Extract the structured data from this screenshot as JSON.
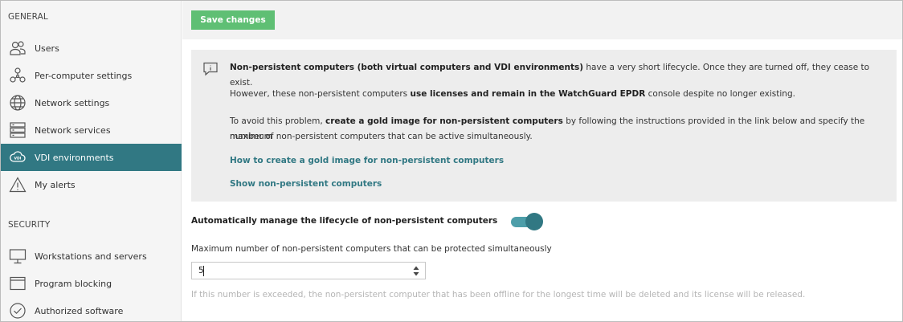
{
  "sidebar": {
    "sections": [
      {
        "title": "GENERAL"
      },
      {
        "title": "SECURITY"
      }
    ],
    "general_items": [
      {
        "label": "Users",
        "icon": "users-icon"
      },
      {
        "label": "Per-computer settings",
        "icon": "network-nodes-icon"
      },
      {
        "label": "Network settings",
        "icon": "globe-icon"
      },
      {
        "label": "Network services",
        "icon": "server-icon"
      },
      {
        "label": "VDI environments",
        "icon": "vdi-cloud-icon",
        "active": true
      },
      {
        "label": "My alerts",
        "icon": "warning-icon"
      }
    ],
    "security_items": [
      {
        "label": "Workstations and servers",
        "icon": "monitor-icon"
      },
      {
        "label": "Program blocking",
        "icon": "window-icon"
      },
      {
        "label": "Authorized software",
        "icon": "check-circle-icon"
      }
    ]
  },
  "toolbar": {
    "save_label": "Save changes"
  },
  "info": {
    "p1_bold": "Non-persistent computers (both virtual computers and VDI environments)",
    "p1_rest": " have a very short lifecycle. Once they are turned off, they cease to exist.",
    "p2_start": "However, these non-persistent computers ",
    "p2_bold": "use licenses and remain in the WatchGuard EPDR",
    "p2_end": " console despite no longer existing.",
    "p3_start": "To avoid this problem, ",
    "p3_bold": "create a gold image for non-persistent computers",
    "p3_end": " by following the instructions provided in the link below and specify the maximum",
    "p3_line2": "number of non-persistent computers that can be active simultaneously.",
    "link1": "How to create a gold image for non-persistent computers",
    "link2": "Show non-persistent computers"
  },
  "lifecycle": {
    "toggle_label": "Automatically manage the lifecycle of non-persistent computers",
    "toggle_on": true,
    "max_label": "Maximum number of non-persistent computers that can be protected simultaneously",
    "max_value": "5",
    "hint": "If this number is exceeded, the non-persistent computer that has been offline for the longest time will be deleted and its license will be released."
  },
  "colors": {
    "accent": "#317883",
    "save_button": "#5fbf74",
    "toggle_track": "#4d9ea9"
  }
}
